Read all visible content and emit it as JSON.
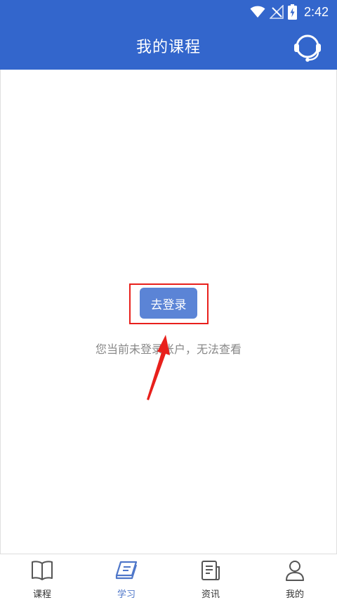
{
  "status_bar": {
    "time": "2:42"
  },
  "header": {
    "title": "我的课程"
  },
  "main": {
    "login_button_label": "去登录",
    "notice": "您当前未登录账户，无法查看"
  },
  "bottom_nav": [
    {
      "label": "课程",
      "icon": "book-open-icon",
      "active": false
    },
    {
      "label": "学习",
      "icon": "study-book-icon",
      "active": true
    },
    {
      "label": "资讯",
      "icon": "news-icon",
      "active": false
    },
    {
      "label": "我的",
      "icon": "user-icon",
      "active": false
    }
  ],
  "colors": {
    "header": "#3366cc",
    "button": "#5b84d6",
    "highlight": "#e8201c",
    "active_tab": "#4f77c9"
  }
}
